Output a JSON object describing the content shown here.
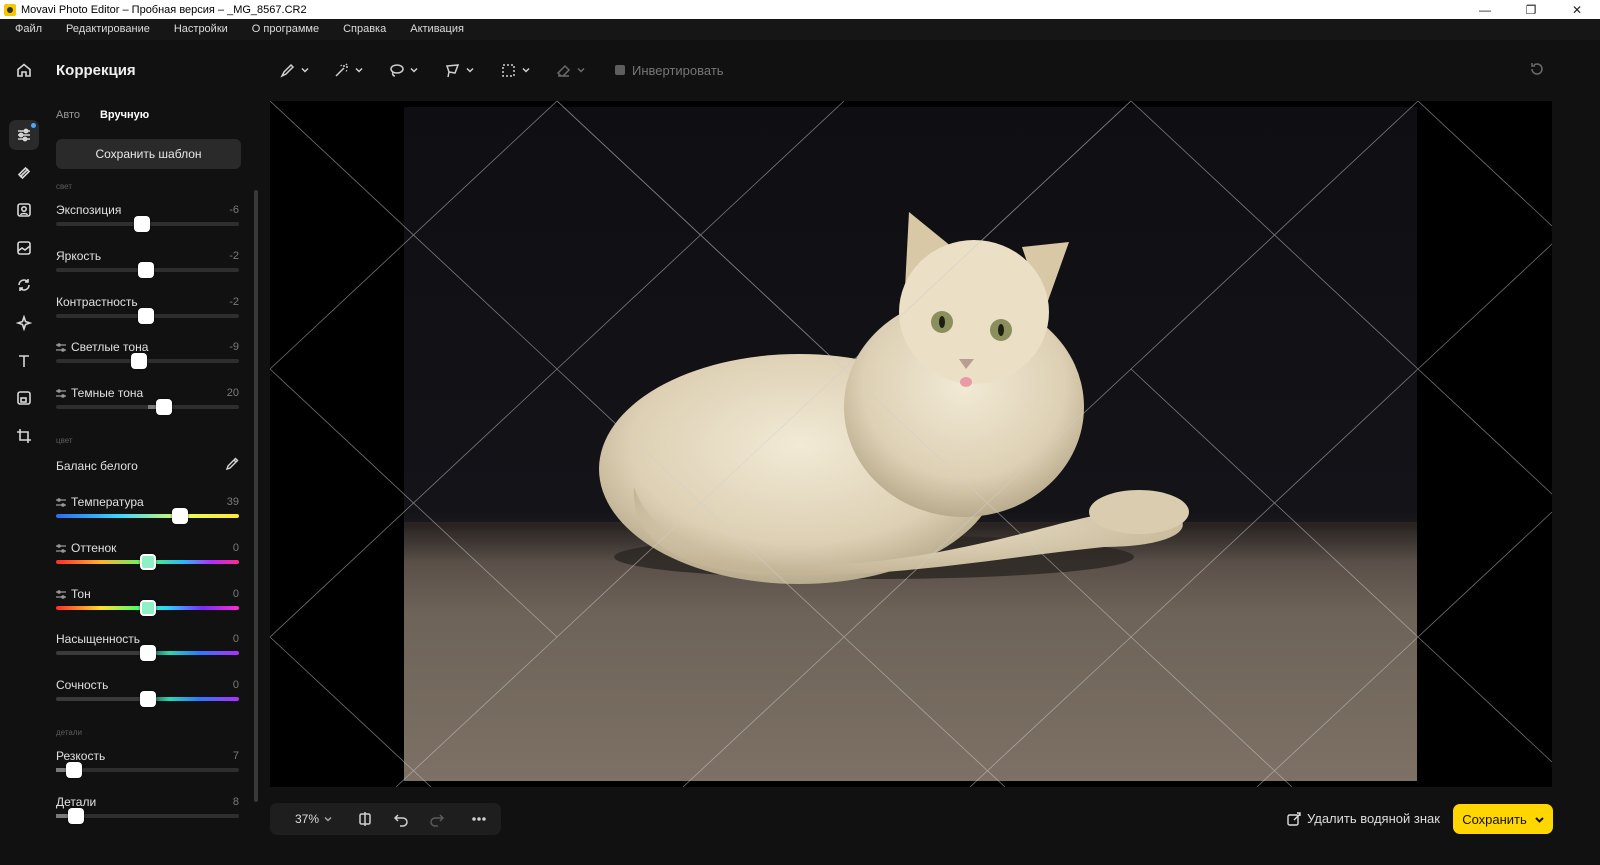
{
  "window": {
    "title": "Movavi Photo Editor – Пробная версия – _MG_8567.CR2"
  },
  "menu": [
    "Файл",
    "Редактирование",
    "Настройки",
    "О программе",
    "Справка",
    "Активация"
  ],
  "panel": {
    "title": "Коррекция",
    "tabs": {
      "auto": "Авто",
      "manual": "Вручную"
    },
    "save_template": "Сохранить шаблон",
    "section_light": "свет",
    "section_color": "цвет",
    "section_details": "детали",
    "light_sliders": [
      {
        "label": "Экспозиция",
        "value": "-6",
        "level": 0.47
      },
      {
        "label": "Яркость",
        "value": "-2",
        "level": 0.49
      },
      {
        "label": "Контрастность",
        "value": "-2",
        "level": 0.49
      },
      {
        "label": "Светлые тона",
        "value": "-9",
        "level": 0.455
      },
      {
        "label": "Темные тона",
        "value": "20",
        "level": 0.59
      }
    ],
    "white_balance": "Баланс белого",
    "color_sliders": [
      {
        "label": "Температура",
        "value": "39",
        "level": 0.68
      },
      {
        "label": "Оттенок",
        "value": "0",
        "level": 0.5
      },
      {
        "label": "Тон",
        "value": "0",
        "level": 0.5
      },
      {
        "label": "Насыщенность",
        "value": "0",
        "level": 0.5
      },
      {
        "label": "Сочность",
        "value": "0",
        "level": 0.5
      }
    ],
    "detail_sliders": [
      {
        "label": "Резкость",
        "value": "7",
        "level": 0.1
      },
      {
        "label": "Детали",
        "value": "8",
        "level": 0.11
      }
    ]
  },
  "toolbar": {
    "invert": "Инвертировать"
  },
  "zoom": {
    "value": "37%"
  },
  "bottom": {
    "remove_watermark": "Удалить водяной знак",
    "save": "Сохранить"
  },
  "colors": {
    "accent": "#ffd600",
    "background": "#111111",
    "rail_active_dot": "#4aa8ff"
  }
}
